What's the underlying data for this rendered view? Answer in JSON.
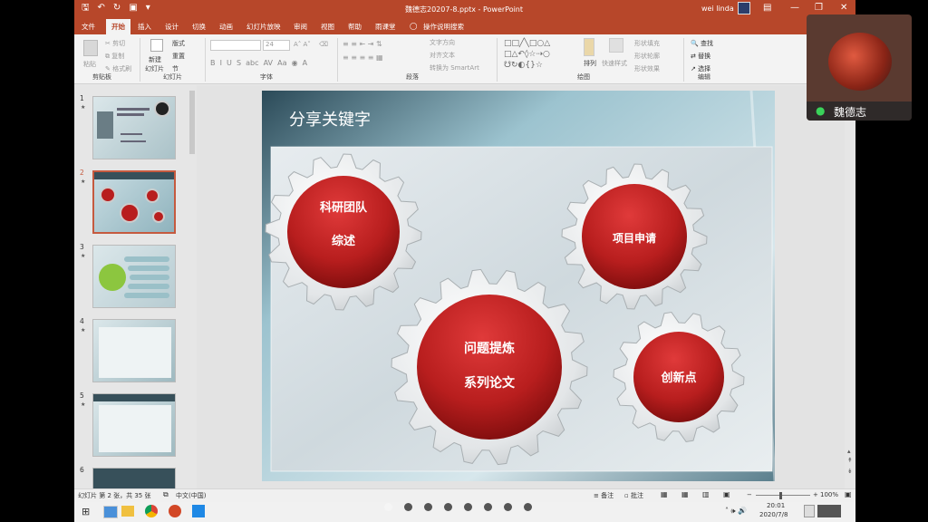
{
  "window": {
    "doc_title": "魏德志20207-8.pptx  -  PowerPoint",
    "user_name": "wei linda"
  },
  "tabs": [
    "文件",
    "开始",
    "插入",
    "设计",
    "切换",
    "动画",
    "幻灯片放映",
    "审阅",
    "视图",
    "帮助",
    "雨课堂"
  ],
  "tell_me": "操作说明搜索",
  "ribbon": {
    "clipboard": {
      "paste": "粘贴",
      "cut": "剪切",
      "copy": "复制",
      "format_painter": "格式刷",
      "label": "剪贴板"
    },
    "slides": {
      "new_slide": "新建",
      "new_slide2": "幻灯片",
      "layout": "版式",
      "reset": "重置",
      "section": "节",
      "label": "幻灯片"
    },
    "font": {
      "size": "24",
      "label": "字体"
    },
    "paragraph": {
      "text_direction": "文字方向",
      "align_text": "对齐文本",
      "smartart": "转换为 SmartArt",
      "label": "段落"
    },
    "drawing": {
      "arrange": "排列",
      "quick_styles": "快速样式",
      "fill": "形状填充",
      "outline": "形状轮廓",
      "effects": "形状效果",
      "label": "绘图"
    },
    "editing": {
      "find": "查找",
      "replace": "替换",
      "select": "选择",
      "label": "编辑"
    }
  },
  "thumbnails": [
    {
      "num": "1"
    },
    {
      "num": "2"
    },
    {
      "num": "3"
    },
    {
      "num": "4"
    },
    {
      "num": "5"
    },
    {
      "num": "6"
    }
  ],
  "slide": {
    "title": "分享关键字",
    "gears": [
      {
        "line1": "科研团队",
        "line2": "综述"
      },
      {
        "line1": "项目申请",
        "line2": ""
      },
      {
        "line1": "问题提炼",
        "line2": "系列论文"
      },
      {
        "line1": "创新点",
        "line2": ""
      }
    ]
  },
  "status": {
    "slide_info": "幻灯片 第 2 张，共 35 张",
    "language": "中文(中国)",
    "notes": "备注",
    "comments": "批注",
    "zoom": "100%"
  },
  "taskbar": {
    "time": "20:01",
    "date": "2020/7/8"
  },
  "video": {
    "name": "魏德志"
  },
  "colors": {
    "accent": "#b7472a",
    "gear_red": "#b81e1e"
  }
}
